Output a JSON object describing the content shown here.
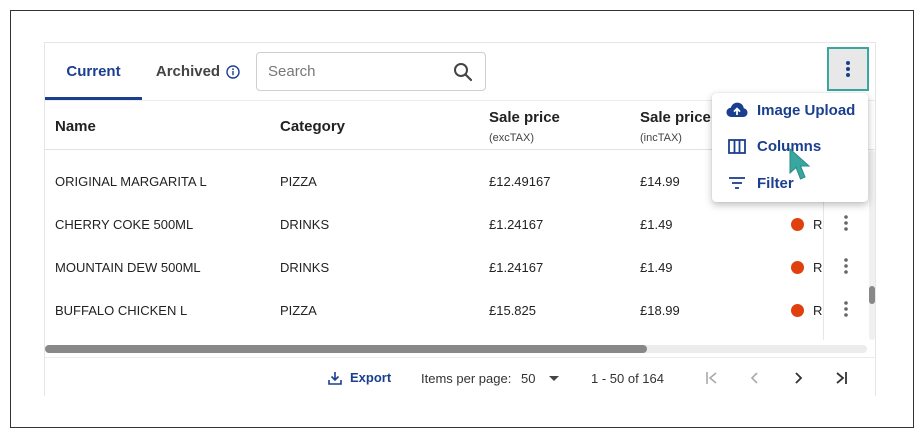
{
  "tabs": [
    {
      "label": "Current",
      "active": true
    },
    {
      "label": "Archived",
      "active": false
    }
  ],
  "search": {
    "placeholder": "Search",
    "value": ""
  },
  "columns": [
    {
      "label": "Name",
      "sub": ""
    },
    {
      "label": "Category",
      "sub": ""
    },
    {
      "label": "Sale price",
      "sub": "(excTAX)"
    },
    {
      "label": "Sale price",
      "sub": "(incTAX)"
    }
  ],
  "rows": [
    {
      "name": "ORIGINAL MARGARITA L",
      "category": "PIZZA",
      "exc": "£12.49167",
      "inc": "£14.99",
      "status": ""
    },
    {
      "name": "CHERRY COKE 500ML",
      "category": "DRINKS",
      "exc": "£1.24167",
      "inc": "£1.49",
      "status": "Re"
    },
    {
      "name": "MOUNTAIN DEW 500ML",
      "category": "DRINKS",
      "exc": "£1.24167",
      "inc": "£1.49",
      "status": "Re"
    },
    {
      "name": "BUFFALO CHICKEN L",
      "category": "PIZZA",
      "exc": "£15.825",
      "inc": "£18.99",
      "status": "Re"
    }
  ],
  "menu": {
    "items": [
      {
        "label": "Image Upload",
        "icon": "cloud-upload-icon"
      },
      {
        "label": "Columns",
        "icon": "columns-icon"
      },
      {
        "label": "Filter",
        "icon": "filter-icon"
      }
    ]
  },
  "footer": {
    "export_label": "Export",
    "items_per_page_label": "Items per page:",
    "items_per_page_value": "50",
    "range": "1 - 50 of 164"
  },
  "colors": {
    "accent": "#1b3f8f",
    "status_dot": "#e0400e",
    "focus_outline": "#3aa6a0",
    "cursor": "#3aa6a0"
  }
}
